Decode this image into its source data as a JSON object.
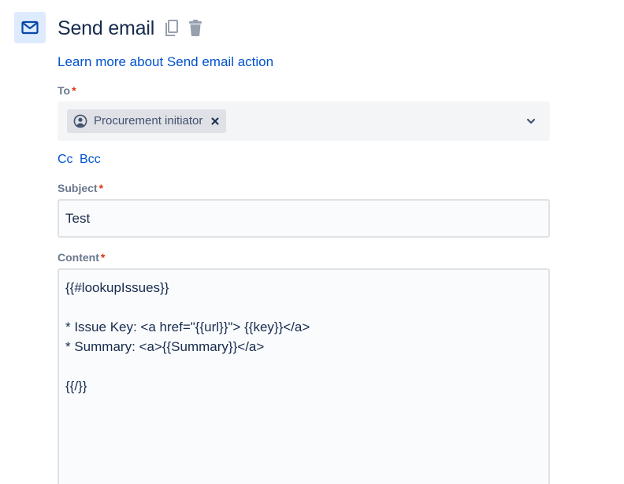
{
  "header": {
    "title": "Send email",
    "icon": "mail-icon",
    "accent_bg": "#deebff",
    "accent_icon": "#0747a6"
  },
  "learn_more": {
    "label": "Learn more about Send email action"
  },
  "to": {
    "label": "To",
    "required_mark": "*",
    "recipients": [
      {
        "label": "Procurement initiator",
        "icon": "person-circle-icon"
      }
    ]
  },
  "cc": {
    "label": "Cc"
  },
  "bcc": {
    "label": "Bcc"
  },
  "subject": {
    "label": "Subject",
    "required_mark": "*",
    "value": "Test"
  },
  "content": {
    "label": "Content",
    "required_mark": "*",
    "value": "{{#lookupIssues}}\n\n* Issue Key: <a href=\"{{url}}\"> {{key}}</a>\n* Summary: <a>{{Summary}}</a>\n\n{{/}}"
  },
  "colors": {
    "link": "#0052cc",
    "required": "#de350b",
    "label": "#6b778c",
    "text": "#172b4d"
  }
}
